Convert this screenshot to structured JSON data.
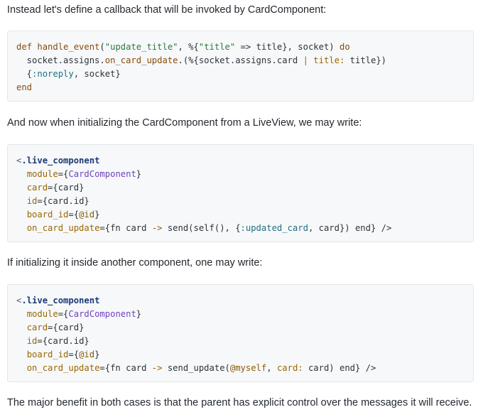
{
  "paragraphs": {
    "p1": "Instead let's define a callback that will be invoked by CardComponent:",
    "p2": "And now when initializing the CardComponent from a LiveView, we may write:",
    "p3": "If initializing it inside another component, one may write:",
    "p4": "The major benefit in both cases is that the parent has explicit control over the messages it will receive."
  },
  "code1": {
    "l1": {
      "a": "def",
      "b": " ",
      "c": "handle_event",
      "d": "(",
      "e": "\"update_title\"",
      "f": ", %{",
      "g": "\"title\"",
      "h": " => title}, socket) ",
      "i": "do"
    },
    "l2": {
      "a": "  socket.assigns.",
      "b": "on_card_update",
      "c": ".(%{socket.assigns.card ",
      "d": "|",
      "e": " ",
      "f": "title:",
      "g": " title})"
    },
    "l3": {
      "a": "  {",
      "b": ":noreply",
      "c": ", socket}"
    },
    "l4": {
      "a": "end"
    }
  },
  "code2": {
    "l1": {
      "a": "<",
      "b": ".live_component"
    },
    "l2": {
      "a": "  ",
      "b": "module",
      "c": "={",
      "d": "CardComponent",
      "e": "}"
    },
    "l3": {
      "a": "  ",
      "b": "card",
      "c": "={card}"
    },
    "l4": {
      "a": "  ",
      "b": "id",
      "c": "={card.id}"
    },
    "l5": {
      "a": "  ",
      "b": "board_id",
      "c": "={",
      "d": "@id",
      "e": "}"
    },
    "l6": {
      "a": "  ",
      "b": "on_card_update",
      "c": "={fn card ",
      "d": "->",
      "e": " send(self(), {",
      "f": ":updated_card",
      "g": ", card}) end} />"
    }
  },
  "code3": {
    "l1": {
      "a": "<",
      "b": ".live_component"
    },
    "l2": {
      "a": "  ",
      "b": "module",
      "c": "={",
      "d": "CardComponent",
      "e": "}"
    },
    "l3": {
      "a": "  ",
      "b": "card",
      "c": "={card}"
    },
    "l4": {
      "a": "  ",
      "b": "id",
      "c": "={card.id}"
    },
    "l5": {
      "a": "  ",
      "b": "board_id",
      "c": "={",
      "d": "@id",
      "e": "}"
    },
    "l6": {
      "a": "  ",
      "b": "on_card_update",
      "c": "={fn card ",
      "d": "->",
      "e": " send_update(",
      "f": "@myself",
      "g": ", ",
      "h": "card:",
      "i": " card) end} />"
    }
  }
}
